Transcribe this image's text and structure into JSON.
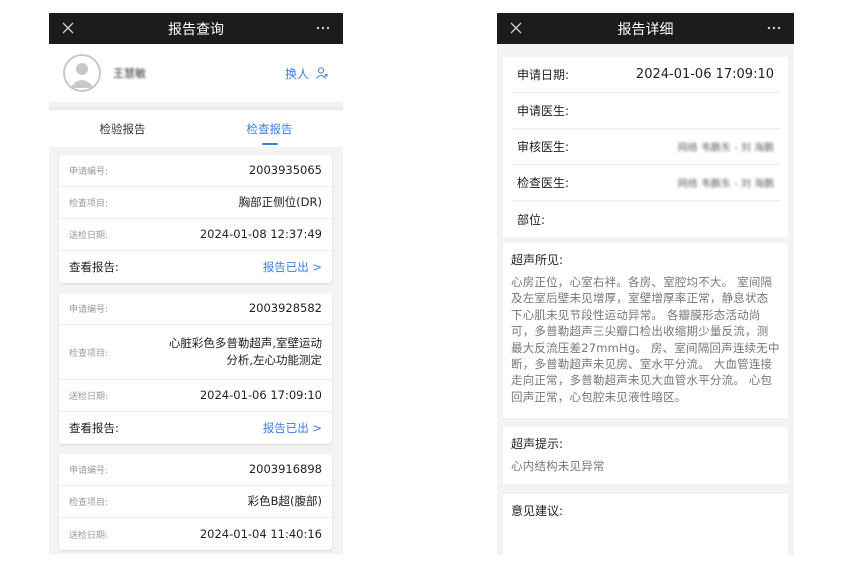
{
  "left": {
    "title": "报告查询",
    "user": {
      "name": "王慧敏",
      "switch_label": "换人"
    },
    "tabs": [
      {
        "label": "检验报告",
        "active": false
      },
      {
        "label": "检查报告",
        "active": true
      }
    ],
    "labels": {
      "apply_no": "申请编号:",
      "exam_item": "检查项目:",
      "send_date": "送检日期:",
      "view_report": "查看报告:"
    },
    "reports": [
      {
        "apply_no": "2003935065",
        "exam_item": "胸部正侧位(DR)",
        "send_date": "2024-01-08 12:37:49",
        "status": "报告已出 >"
      },
      {
        "apply_no": "2003928582",
        "exam_item_line1": "心脏彩色多普勒超声,室壁运动",
        "exam_item_line2": "分析,左心功能测定",
        "send_date": "2024-01-06 17:09:10",
        "status": "报告已出 >"
      },
      {
        "apply_no": "2003916898",
        "exam_item": "彩色B超(腹部)",
        "send_date": "2024-01-04 11:40:16"
      }
    ]
  },
  "right": {
    "title": "报告详细",
    "info": [
      {
        "label": "申请日期:",
        "value": "2024-01-06 17:09:10"
      },
      {
        "label": "申请医生:",
        "value": ""
      },
      {
        "label": "审核医生:",
        "value": "网络 韦鹏东 - 刘 海鹏"
      },
      {
        "label": "检查医生:",
        "value": "网络 韦鹏东 - 刘 海鹏"
      },
      {
        "label": "部位:",
        "value": ""
      }
    ],
    "findings": {
      "title": "超声所见:",
      "body": "心房正位，心室右袢。各房、室腔均不大。 室间隔及左室后壁未见增厚，室壁增厚率正常，静息状态下心肌未见节段性运动异常。 各瓣膜形态活动尚可，多普勒超声三尖瓣口检出收缩期少量反流，测最大反流压差27mmHg。 房、室间隔回声连续无中断，多普勒超声未见房、室水平分流。 大血管连接走向正常，多普勒超声未见大血管水平分流。 心包回声正常，心包腔未见液性暗区。"
    },
    "hint": {
      "title": "超声提示:",
      "body": "心内结构未见异常"
    },
    "advice": {
      "title": "意见建议:"
    }
  },
  "colors": {
    "accent": "#3a7ee3",
    "navbar": "#1c1c1c",
    "background": "#f3f3f5"
  },
  "icons": {
    "close": "close-icon",
    "more": "more-icon",
    "switch": "switch-user-icon",
    "avatar": "avatar-placeholder"
  }
}
